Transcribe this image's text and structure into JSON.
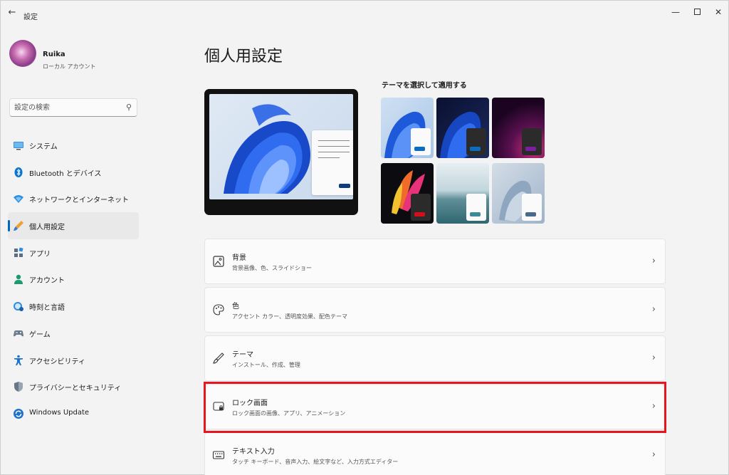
{
  "window": {
    "title": "設定"
  },
  "profile": {
    "name": "Ruika",
    "account_type": "ローカル アカウント"
  },
  "search": {
    "placeholder": "設定の検索"
  },
  "sidebar": {
    "items": [
      {
        "label": "システム",
        "icon": "system-icon"
      },
      {
        "label": "Bluetooth とデバイス",
        "icon": "bluetooth-icon"
      },
      {
        "label": "ネットワークとインターネット",
        "icon": "network-icon"
      },
      {
        "label": "個人用設定",
        "icon": "personalization-icon",
        "active": true
      },
      {
        "label": "アプリ",
        "icon": "apps-icon"
      },
      {
        "label": "アカウント",
        "icon": "account-icon"
      },
      {
        "label": "時刻と言語",
        "icon": "time-language-icon"
      },
      {
        "label": "ゲーム",
        "icon": "gaming-icon"
      },
      {
        "label": "アクセシビリティ",
        "icon": "accessibility-icon"
      },
      {
        "label": "プライバシーとセキュリティ",
        "icon": "privacy-shield-icon"
      },
      {
        "label": "Windows Update",
        "icon": "windows-update-icon"
      }
    ]
  },
  "main": {
    "title": "個人用設定",
    "themes_label": "テーマを選択して適用する",
    "themes": [
      {
        "name": "light-bloom",
        "swatch": "#0f6cbd"
      },
      {
        "name": "dark-bloom",
        "swatch": "#0f6cbd"
      },
      {
        "name": "glow",
        "swatch": "#7a1fa2"
      },
      {
        "name": "captured-motion",
        "swatch": "#d1101c"
      },
      {
        "name": "sunrise",
        "swatch": "#3f8a95"
      },
      {
        "name": "flow",
        "swatch": "#4a6a8a"
      }
    ],
    "settings": [
      {
        "title": "背景",
        "subtitle": "背景画像、色、スライドショー",
        "icon": "image-icon"
      },
      {
        "title": "色",
        "subtitle": "アクセント カラー、透明度効果、配色テーマ",
        "icon": "palette-icon"
      },
      {
        "title": "テーマ",
        "subtitle": "インストール、作成、管理",
        "icon": "brush-icon"
      },
      {
        "title": "ロック画面",
        "subtitle": "ロック画面の画像、アプリ、アニメーション",
        "icon": "lock-screen-icon"
      },
      {
        "title": "テキスト入力",
        "subtitle": "タッチ キーボード、音声入力、絵文字など、入力方式エディター",
        "icon": "keyboard-icon"
      }
    ]
  },
  "colors": {
    "accent": "#0067c0",
    "highlight": "#e8141e"
  }
}
